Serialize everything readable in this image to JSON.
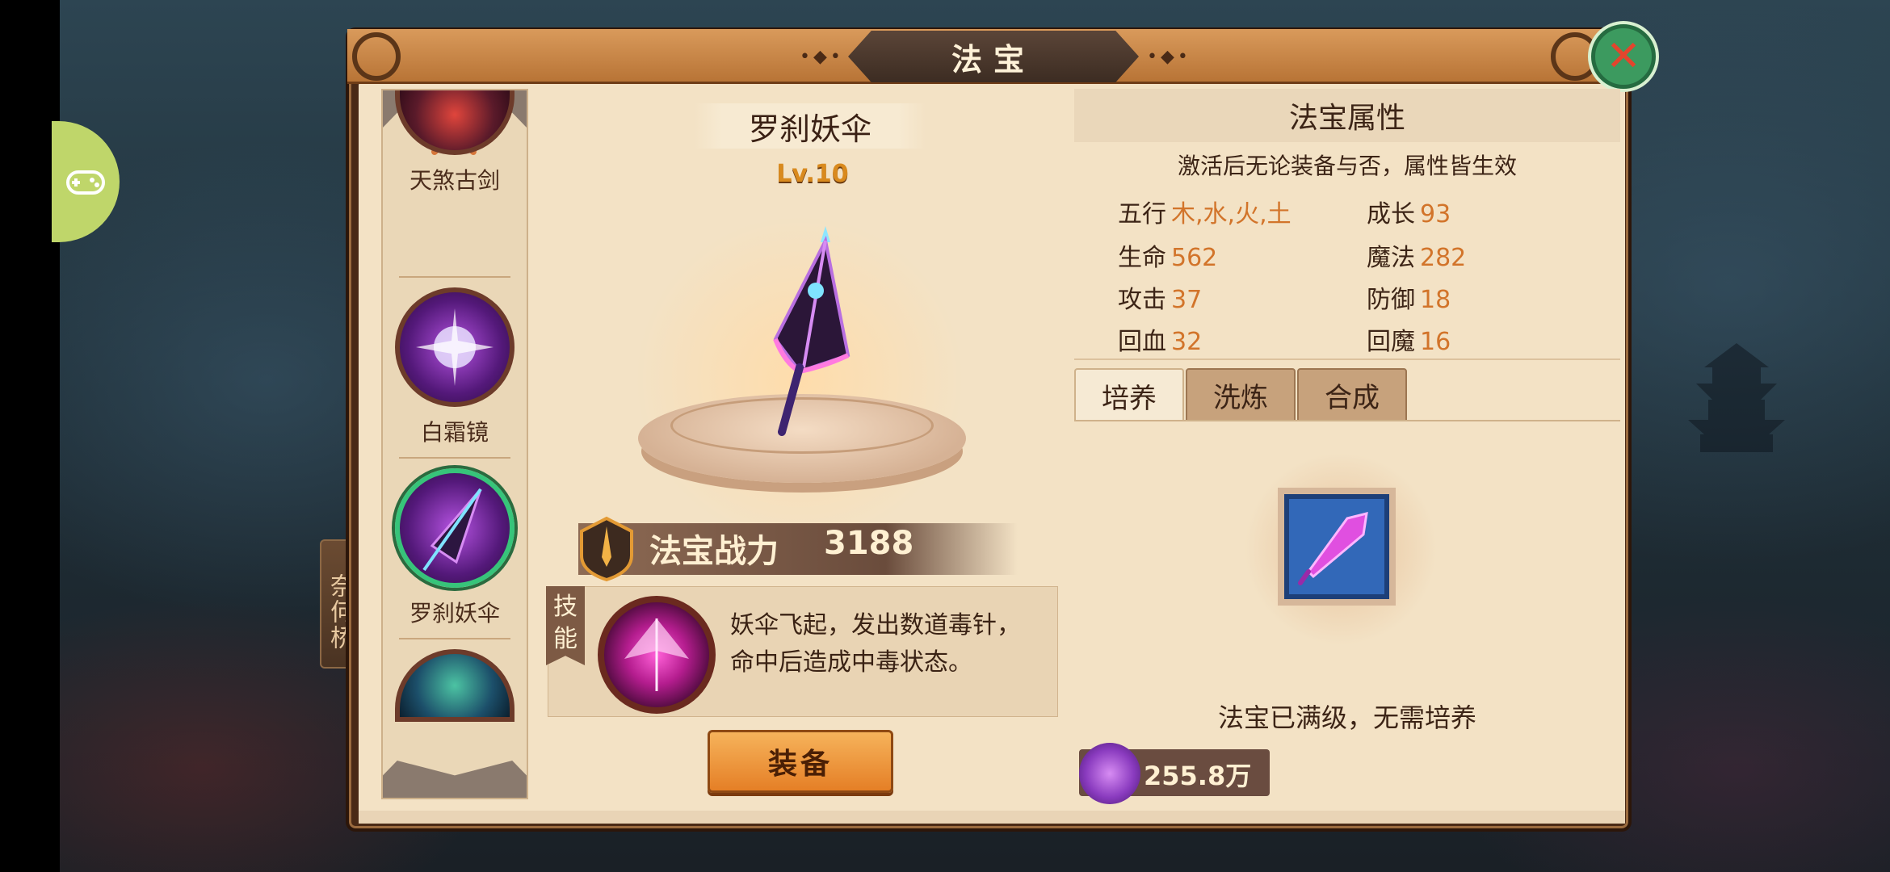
{
  "window": {
    "title": "法宝"
  },
  "side_tag": {
    "label": "奈何桥"
  },
  "treasure_list": {
    "items": [
      {
        "label": "天煞古剑",
        "icon": "sword-icon"
      },
      {
        "label": "白霜镜",
        "icon": "mirror-icon"
      },
      {
        "label": "罗刹妖伞",
        "icon": "umbrella-icon",
        "selected": true
      },
      {
        "label": "",
        "icon": "claw-icon"
      }
    ]
  },
  "detail": {
    "name": "罗刹妖伞",
    "level": "Lv.10",
    "power_label": "法宝战力",
    "power_value": "3188",
    "skill_tag": "技能",
    "skill_desc_line1": "妖伞飞起，发出数道毒针，",
    "skill_desc_line2": "命中后造成中毒状态。",
    "equip_label": "装备"
  },
  "attributes": {
    "title": "法宝属性",
    "note": "激活后无论装备与否，属性皆生效",
    "rows": [
      {
        "k1": "五行",
        "v1": "木,水,火,土",
        "k2": "成长",
        "v2": "93"
      },
      {
        "k1": "生命",
        "v1": "562",
        "k2": "魔法",
        "v2": "282"
      },
      {
        "k1": "攻击",
        "v1": "37",
        "k2": "防御",
        "v2": "18"
      },
      {
        "k1": "回血",
        "v1": "32",
        "k2": "回魔",
        "v2": "16"
      }
    ]
  },
  "tabs": [
    {
      "label": "培养",
      "active": true
    },
    {
      "label": "洗炼",
      "active": false
    },
    {
      "label": "合成",
      "active": false
    }
  ],
  "cultivate": {
    "maxed_text": "法宝已满级，无需培养",
    "currency_value": "255.8万"
  },
  "colors": {
    "accent_orange": "#d2742a",
    "panel_bg": "#f3e2c5",
    "close_green": "#3c9a5f"
  }
}
